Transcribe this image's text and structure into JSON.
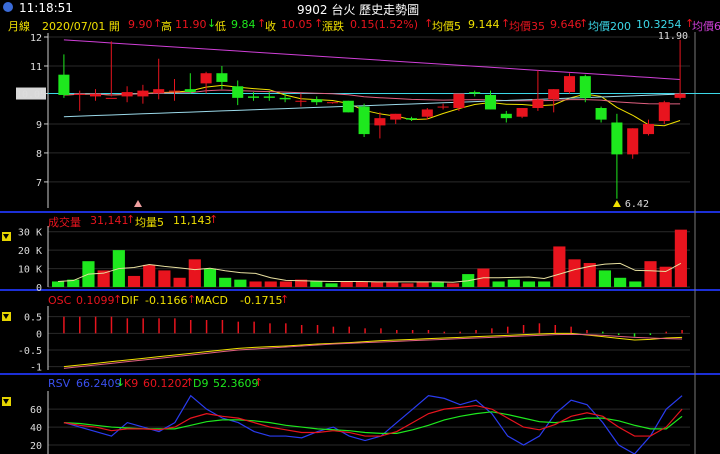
{
  "header": {
    "time": "11:18:51",
    "title": "9902 台火  歷史走勢圖"
  },
  "price_row": {
    "period_label": "月線",
    "date_label": "2020/07/01 開",
    "open": "9.90",
    "high_label": "高",
    "high": "11.90",
    "low_label": "低",
    "low": "9.84",
    "close_label": "收",
    "close": "10.05",
    "change_label": "漲跌",
    "change": "0.15(1.52%)",
    "ma5_label": "均價5",
    "ma5": "9.144",
    "ma35_label": "均價35",
    "ma35": "9.646",
    "ma200_label": "均價200",
    "ma200": "10.3254",
    "extra_label": "均價6"
  },
  "price_axis": {
    "ticks": [
      "12",
      "11",
      "10.05",
      "9",
      "8",
      "7"
    ],
    "current_tag": "10.05",
    "high_marker": "11.90",
    "low_marker": "6.42"
  },
  "volume_row": {
    "label": "成交量",
    "value": "31,141",
    "ma_label": "均量5",
    "ma_value": "11,143",
    "ticks": [
      "30 K",
      "20 K",
      "10 K",
      "0"
    ]
  },
  "macd_row": {
    "osc_label": "OSC",
    "osc": "0.1099",
    "dif_label": "DIF",
    "dif": "-0.1166",
    "macd_label": "MACD",
    "macd": "-0.1715",
    "ticks": [
      "0.5",
      "0",
      "-0.5",
      "-1"
    ]
  },
  "kd_row": {
    "rsv_label": "RSV",
    "rsv": "66.2409",
    "k_label": "K9",
    "k": "60.1202",
    "d_label": "D9",
    "d": "52.3609",
    "ticks": [
      "60",
      "40",
      "20"
    ]
  },
  "colors": {
    "up": "#e8141e",
    "down": "#1ee81e",
    "separator": "#1c2fd6",
    "yellow": "#f0e000",
    "cyan": "#3cd8e8",
    "magenta": "#d040d8"
  },
  "chart_data": {
    "type": "candlestick",
    "candles": [
      {
        "o": 10.7,
        "h": 11.4,
        "l": 9.9,
        "c": 10.0
      },
      {
        "o": 10.0,
        "h": 10.15,
        "l": 9.45,
        "c": 10.05
      },
      {
        "o": 9.95,
        "h": 10.2,
        "l": 9.8,
        "c": 10.05
      },
      {
        "o": 9.9,
        "h": 11.85,
        "l": 9.95,
        "c": 9.9
      },
      {
        "o": 9.95,
        "h": 10.3,
        "l": 9.75,
        "c": 10.1
      },
      {
        "o": 9.95,
        "h": 10.35,
        "l": 9.7,
        "c": 10.15
      },
      {
        "o": 10.05,
        "h": 11.25,
        "l": 9.85,
        "c": 10.2
      },
      {
        "o": 10.15,
        "h": 10.55,
        "l": 9.8,
        "c": 10.15
      },
      {
        "o": 10.2,
        "h": 10.75,
        "l": 10.05,
        "c": 10.1
      },
      {
        "o": 10.4,
        "h": 10.8,
        "l": 10.05,
        "c": 10.75
      },
      {
        "o": 10.75,
        "h": 11.0,
        "l": 10.2,
        "c": 10.45
      },
      {
        "o": 10.3,
        "h": 10.5,
        "l": 9.65,
        "c": 9.9
      },
      {
        "o": 9.95,
        "h": 10.1,
        "l": 9.8,
        "c": 9.9
      },
      {
        "o": 9.95,
        "h": 10.1,
        "l": 9.8,
        "c": 9.9
      },
      {
        "o": 9.9,
        "h": 10.05,
        "l": 9.75,
        "c": 9.85
      },
      {
        "o": 9.8,
        "h": 10.05,
        "l": 9.6,
        "c": 9.8
      },
      {
        "o": 9.85,
        "h": 9.95,
        "l": 9.65,
        "c": 9.75
      },
      {
        "o": 9.75,
        "h": 9.75,
        "l": 9.7,
        "c": 9.75
      },
      {
        "o": 9.8,
        "h": 9.8,
        "l": 9.4,
        "c": 9.4
      },
      {
        "o": 9.6,
        "h": 9.7,
        "l": 8.55,
        "c": 8.65
      },
      {
        "o": 8.95,
        "h": 9.4,
        "l": 8.5,
        "c": 9.2
      },
      {
        "o": 9.15,
        "h": 9.35,
        "l": 9.0,
        "c": 9.35
      },
      {
        "o": 9.2,
        "h": 9.25,
        "l": 9.1,
        "c": 9.15
      },
      {
        "o": 9.25,
        "h": 9.55,
        "l": 9.15,
        "c": 9.5
      },
      {
        "o": 9.6,
        "h": 9.7,
        "l": 9.5,
        "c": 9.6
      },
      {
        "o": 9.55,
        "h": 10.05,
        "l": 9.45,
        "c": 10.05
      },
      {
        "o": 10.1,
        "h": 10.15,
        "l": 9.95,
        "c": 10.05
      },
      {
        "o": 10.0,
        "h": 10.15,
        "l": 9.5,
        "c": 9.5
      },
      {
        "o": 9.35,
        "h": 9.45,
        "l": 9.05,
        "c": 9.2
      },
      {
        "o": 9.25,
        "h": 9.55,
        "l": 9.2,
        "c": 9.55
      },
      {
        "o": 9.55,
        "h": 10.85,
        "l": 9.45,
        "c": 9.85
      },
      {
        "o": 9.85,
        "h": 10.2,
        "l": 9.4,
        "c": 10.2
      },
      {
        "o": 10.1,
        "h": 10.75,
        "l": 10.05,
        "c": 10.65
      },
      {
        "o": 10.65,
        "h": 10.7,
        "l": 9.75,
        "c": 9.9
      },
      {
        "o": 9.55,
        "h": 9.6,
        "l": 9.05,
        "c": 9.15
      },
      {
        "o": 9.05,
        "h": 9.35,
        "l": 6.42,
        "c": 7.95
      },
      {
        "o": 7.95,
        "h": 8.85,
        "l": 7.8,
        "c": 8.85
      },
      {
        "o": 8.65,
        "h": 9.15,
        "l": 8.6,
        "c": 9.0
      },
      {
        "o": 9.1,
        "h": 9.8,
        "l": 9.0,
        "c": 9.75
      },
      {
        "o": 9.9,
        "h": 11.9,
        "l": 9.84,
        "c": 10.05
      }
    ],
    "volume": [
      3,
      4,
      14,
      9,
      20,
      6,
      12,
      9,
      5,
      15,
      10,
      5,
      4,
      3,
      3,
      3,
      4,
      3,
      2,
      3,
      3,
      3,
      3,
      2,
      3,
      3,
      2,
      7,
      10,
      3,
      4,
      3,
      3,
      22,
      15,
      13,
      9,
      5,
      3,
      14,
      11,
      31.1
    ],
    "volume_colors": [
      "g",
      "g",
      "g",
      "r",
      "g",
      "r",
      "r",
      "r",
      "r",
      "r",
      "g",
      "g",
      "g",
      "r",
      "r",
      "r",
      "r",
      "g",
      "g",
      "r",
      "r",
      "r",
      "r",
      "r",
      "r",
      "g",
      "r",
      "g",
      "r",
      "g",
      "g",
      "g",
      "g",
      "r",
      "r",
      "r",
      "g",
      "g",
      "g",
      "r",
      "r",
      "r"
    ],
    "osc": [
      0.5,
      0.5,
      0.5,
      0.5,
      0.45,
      0.45,
      0.45,
      0.45,
      0.4,
      0.4,
      0.4,
      0.35,
      0.35,
      0.3,
      0.3,
      0.25,
      0.25,
      0.2,
      0.2,
      0.15,
      0.15,
      0.1,
      0.1,
      0.1,
      0.05,
      0.05,
      0.1,
      0.15,
      0.2,
      0.25,
      0.3,
      0.25,
      0.2,
      0.1,
      0.05,
      -0.05,
      -0.1,
      -0.05,
      0.05,
      0.1
    ],
    "osc_colors": [
      "r",
      "r",
      "r",
      "r",
      "r",
      "r",
      "r",
      "r",
      "r",
      "r",
      "r",
      "r",
      "r",
      "r",
      "r",
      "r",
      "r",
      "r",
      "r",
      "r",
      "r",
      "r",
      "r",
      "r",
      "r",
      "r",
      "r",
      "r",
      "r",
      "r",
      "r",
      "r",
      "r",
      "r",
      "g",
      "g",
      "g",
      "g",
      "r",
      "r"
    ],
    "dif": [
      -1.0,
      -0.95,
      -0.9,
      -0.85,
      -0.8,
      -0.75,
      -0.7,
      -0.65,
      -0.6,
      -0.55,
      -0.5,
      -0.45,
      -0.42,
      -0.4,
      -0.38,
      -0.35,
      -0.32,
      -0.3,
      -0.28,
      -0.25,
      -0.22,
      -0.2,
      -0.18,
      -0.16,
      -0.14,
      -0.12,
      -0.1,
      -0.08,
      -0.06,
      -0.04,
      -0.02,
      0.0,
      0.0,
      -0.05,
      -0.1,
      -0.15,
      -0.2,
      -0.18,
      -0.14,
      -0.12
    ],
    "macd": [
      -1.05,
      -1.0,
      -0.95,
      -0.9,
      -0.85,
      -0.8,
      -0.75,
      -0.7,
      -0.65,
      -0.6,
      -0.55,
      -0.5,
      -0.47,
      -0.44,
      -0.41,
      -0.38,
      -0.35,
      -0.32,
      -0.3,
      -0.28,
      -0.26,
      -0.24,
      -0.22,
      -0.2,
      -0.18,
      -0.16,
      -0.14,
      -0.12,
      -0.1,
      -0.08,
      -0.06,
      -0.04,
      -0.03,
      -0.04,
      -0.06,
      -0.09,
      -0.12,
      -0.14,
      -0.16,
      -0.17
    ],
    "rsv": [
      45,
      40,
      35,
      30,
      45,
      40,
      35,
      45,
      75,
      60,
      50,
      45,
      35,
      30,
      30,
      28,
      35,
      40,
      30,
      25,
      30,
      45,
      60,
      75,
      72,
      65,
      70,
      55,
      30,
      20,
      30,
      55,
      70,
      65,
      45,
      20,
      10,
      30,
      60,
      75
    ],
    "k9": [
      45,
      42,
      40,
      36,
      38,
      38,
      37,
      40,
      50,
      55,
      52,
      50,
      45,
      40,
      37,
      34,
      34,
      36,
      34,
      30,
      30,
      35,
      45,
      55,
      60,
      62,
      64,
      60,
      50,
      40,
      37,
      43,
      52,
      56,
      52,
      40,
      30,
      30,
      40,
      60
    ],
    "d9": [
      45,
      44,
      42,
      40,
      39,
      38,
      38,
      38,
      42,
      46,
      48,
      48,
      47,
      45,
      42,
      40,
      38,
      37,
      36,
      34,
      33,
      33,
      37,
      42,
      48,
      52,
      55,
      57,
      54,
      50,
      46,
      45,
      47,
      50,
      50,
      47,
      42,
      38,
      38,
      52
    ]
  }
}
